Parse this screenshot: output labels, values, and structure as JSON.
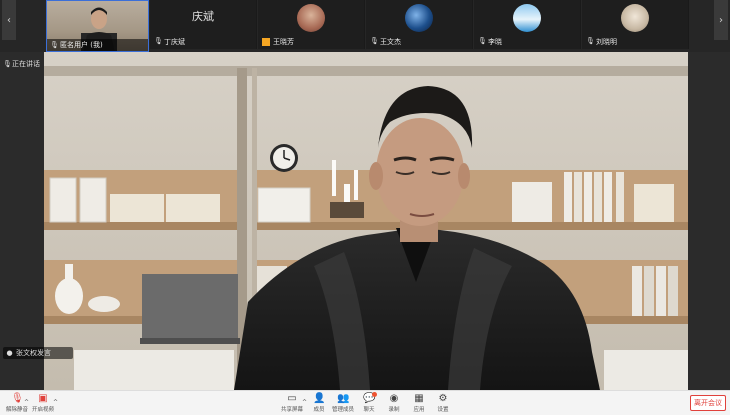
{
  "top_strip": {
    "self_tile": {
      "name": "匿名用户 (我)"
    },
    "participants": [
      {
        "text_avatar": "庆斌",
        "name": "丁庆斌"
      },
      {
        "name": "王晓芳"
      },
      {
        "name": "王文杰"
      },
      {
        "name": "李晓"
      },
      {
        "name": "刘晓明"
      }
    ],
    "nav_left": "‹",
    "nav_right": "›"
  },
  "left_rail": {
    "speaker_label": "正在讲话",
    "active_speaker_label": "张文权发言"
  },
  "toolbar": {
    "mute_label": "解除静音",
    "video_label": "开启视频",
    "share_label": "共享屏幕",
    "members_label": "成员",
    "invite_label": "管理成员",
    "chat_label": "聊天",
    "record_label": "录制",
    "apps_label": "应用",
    "settings_label": "设置",
    "end_label": "离开会议"
  },
  "colors": {
    "accent": "#3b6fd8",
    "end": "#e0413b"
  }
}
